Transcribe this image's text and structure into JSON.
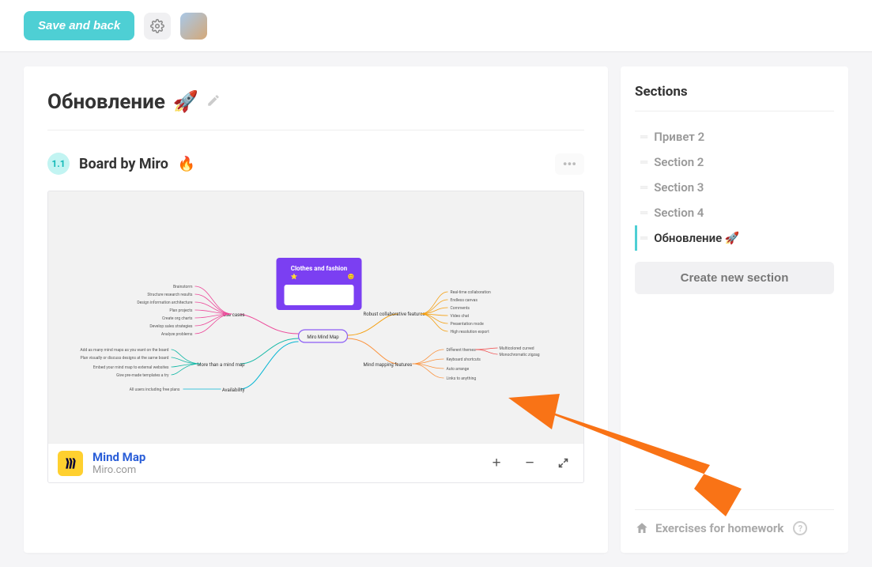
{
  "topbar": {
    "save_label": "Save and back"
  },
  "main": {
    "title": "Обновление",
    "title_emoji": "🚀",
    "board": {
      "badge": "1.1",
      "title": "Board by Miro",
      "emoji": "🔥"
    },
    "embed": {
      "title": "Mind Map",
      "source": "Miro.com",
      "plus": "+",
      "minus": "−"
    }
  },
  "mindmap": {
    "poster_title": "Clothes and fashion",
    "center": "Miro Mind Map",
    "left1": "Use cases",
    "left1_children": [
      "Brainstorm",
      "Structure research results",
      "Design information architecture",
      "Plan projects",
      "Create org charts",
      "Develop sales strategies",
      "Analyze problems"
    ],
    "left2": "More than a mind map",
    "left2_children": [
      "Add as many mind maps as you want on the board",
      "Plan visually or discuss designs at the same board",
      "Embed your mind map to external websites",
      "Give pre-made templates a try"
    ],
    "left3": "Availability",
    "left3_children": [
      "All users including free plans"
    ],
    "right1": "Robust collaborative features",
    "right1_children": [
      "Real-time collaboration",
      "Endless canvas",
      "Comments",
      "Video chat",
      "Presentation mode",
      "High resolution export"
    ],
    "right2": "Mind mapping features",
    "right2_children": [
      "Different themes",
      "Keyboard shortcuts",
      "Auto arrange",
      "Links to anything"
    ],
    "right2_sub": [
      "Multicolored curved",
      "Monochromatic zigzag"
    ]
  },
  "sidebar": {
    "title": "Sections",
    "items": [
      {
        "label": "Привет 2",
        "active": false
      },
      {
        "label": "Section 2",
        "active": false
      },
      {
        "label": "Section 3",
        "active": false
      },
      {
        "label": "Section 4",
        "active": false
      },
      {
        "label": "Обновление 🚀",
        "active": true
      }
    ],
    "create_label": "Create new section",
    "homework_label": "Exercises for homework"
  }
}
